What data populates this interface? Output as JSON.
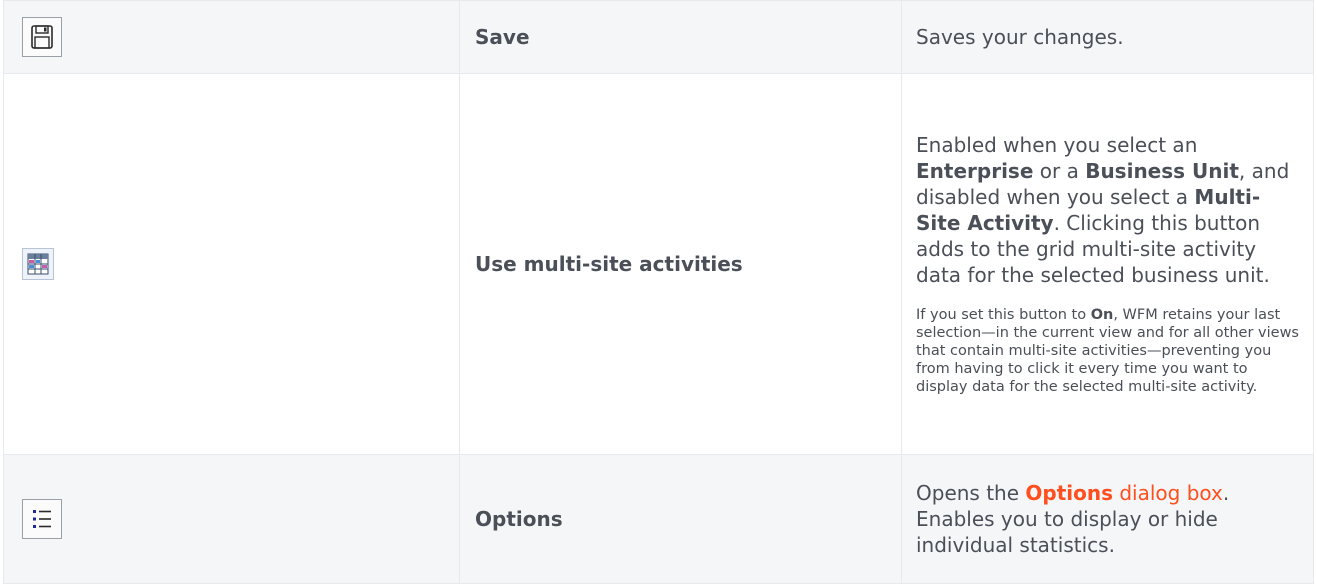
{
  "rows": [
    {
      "name": "Save",
      "icon": "save-icon",
      "description": "Saves your changes."
    },
    {
      "name": "Use multi-site activities",
      "icon": "multi-site-activities-icon",
      "desc_parts": {
        "p1_a": "Enabled when you select an ",
        "p1_b": "Enterprise",
        "p1_c": " or a ",
        "p1_d": "Business Unit",
        "p1_e": ", and disabled when you select a ",
        "p1_f": "Multi-Site Activity",
        "p1_g": ". Clicking this button adds to the grid multi-site activity data for the selected business unit.",
        "p2_a": "If you set this button to ",
        "p2_b": "On",
        "p2_c": ",  WFM retains your last selection—in the current view and for all other views that contain multi-site activities—preventing you from having to click it every time you want to display data for the selected multi-site activity."
      }
    },
    {
      "name": "Options",
      "icon": "options-list-icon",
      "desc_parts": {
        "a": "Opens the ",
        "link_bold": "Options",
        "link_rest": " dialog box",
        "b": ". Enables you to display or hide individual statistics."
      }
    }
  ],
  "colors": {
    "text": "#4a4f58",
    "link": "#ff4f1f",
    "row_shade": "#f5f6f8",
    "border": "#e6e9ee"
  }
}
